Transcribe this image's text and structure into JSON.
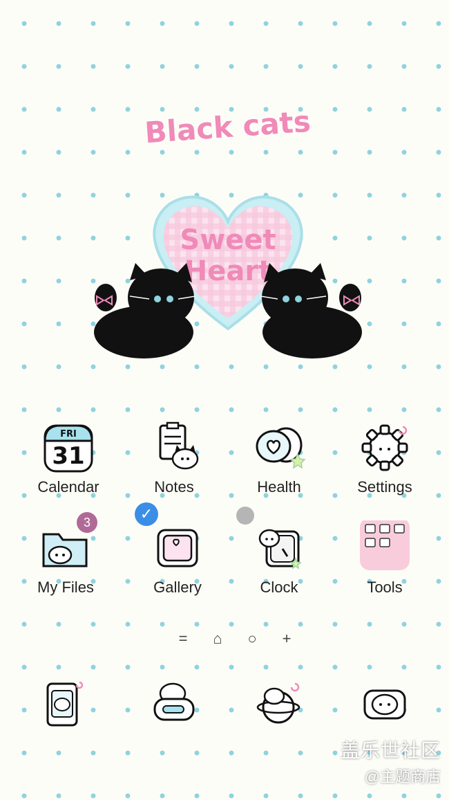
{
  "wallpaper": {
    "title_text": "Black cats",
    "heart_text_line1": "Sweet",
    "heart_text_line2": "Heart",
    "pink": "#f08ab8",
    "dot_color": "#8fd3df"
  },
  "apps": [
    {
      "label": "Calendar",
      "icon": "calendar-icon",
      "day": "FRI",
      "date": "31"
    },
    {
      "label": "Notes",
      "icon": "notes-icon"
    },
    {
      "label": "Health",
      "icon": "health-icon"
    },
    {
      "label": "Settings",
      "icon": "settings-icon"
    },
    {
      "label": "My Files",
      "icon": "folder-icon",
      "badge": "3"
    },
    {
      "label": "Gallery",
      "icon": "gallery-icon",
      "badge": "✓"
    },
    {
      "label": "Clock",
      "icon": "clock-icon"
    },
    {
      "label": "Tools",
      "icon": "tools-folder-icon"
    }
  ],
  "page_indicator": [
    "=",
    "⌂",
    "○",
    "+"
  ],
  "dock": [
    {
      "icon": "phone-icon"
    },
    {
      "icon": "messages-icon"
    },
    {
      "icon": "internet-icon"
    },
    {
      "icon": "camera-icon"
    }
  ],
  "watermark": {
    "line1": "盖乐世社区",
    "line2": "@主题商店"
  }
}
